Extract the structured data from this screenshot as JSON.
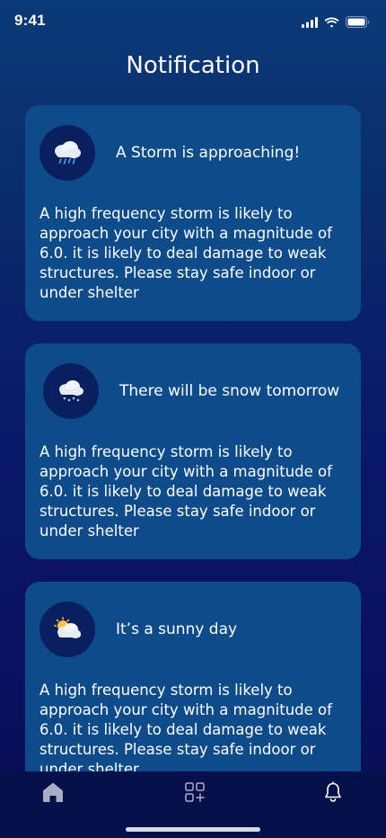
{
  "status_bar": {
    "time": "9:41",
    "icons": [
      "cellular-signal-icon",
      "wifi-icon",
      "battery-icon"
    ]
  },
  "page": {
    "title": "Notification"
  },
  "notifications": [
    {
      "icon": "storm-cloud-icon",
      "title": "A Storm is approaching!",
      "body": "A high frequency storm is likely to approach your city with a magnitude of 6.0. it is likely to deal damage to weak structures. Please stay safe indoor or under shelter"
    },
    {
      "icon": "snow-cloud-icon",
      "title": "There will be snow tomorrow",
      "body": "A high frequency storm is likely to approach your city with a magnitude of 6.0. it is likely to deal damage to weak structures. Please stay safe indoor or under shelter"
    },
    {
      "icon": "sun-cloud-icon",
      "title": "It’s a sunny day",
      "body": "A high frequency storm is likely to approach your city with a magnitude of 6.0. it is likely to deal damage to weak structures. Please stay safe indoor or under shelter"
    }
  ],
  "bottom_nav": {
    "items": [
      {
        "icon": "home-icon",
        "active": true
      },
      {
        "icon": "widgets-add-icon",
        "active": false
      },
      {
        "icon": "bell-icon",
        "active": false
      }
    ]
  },
  "colors": {
    "card_background": "#0d4b8a",
    "icon_circle": "#0a1f5e",
    "nav_background": "#06104a"
  }
}
